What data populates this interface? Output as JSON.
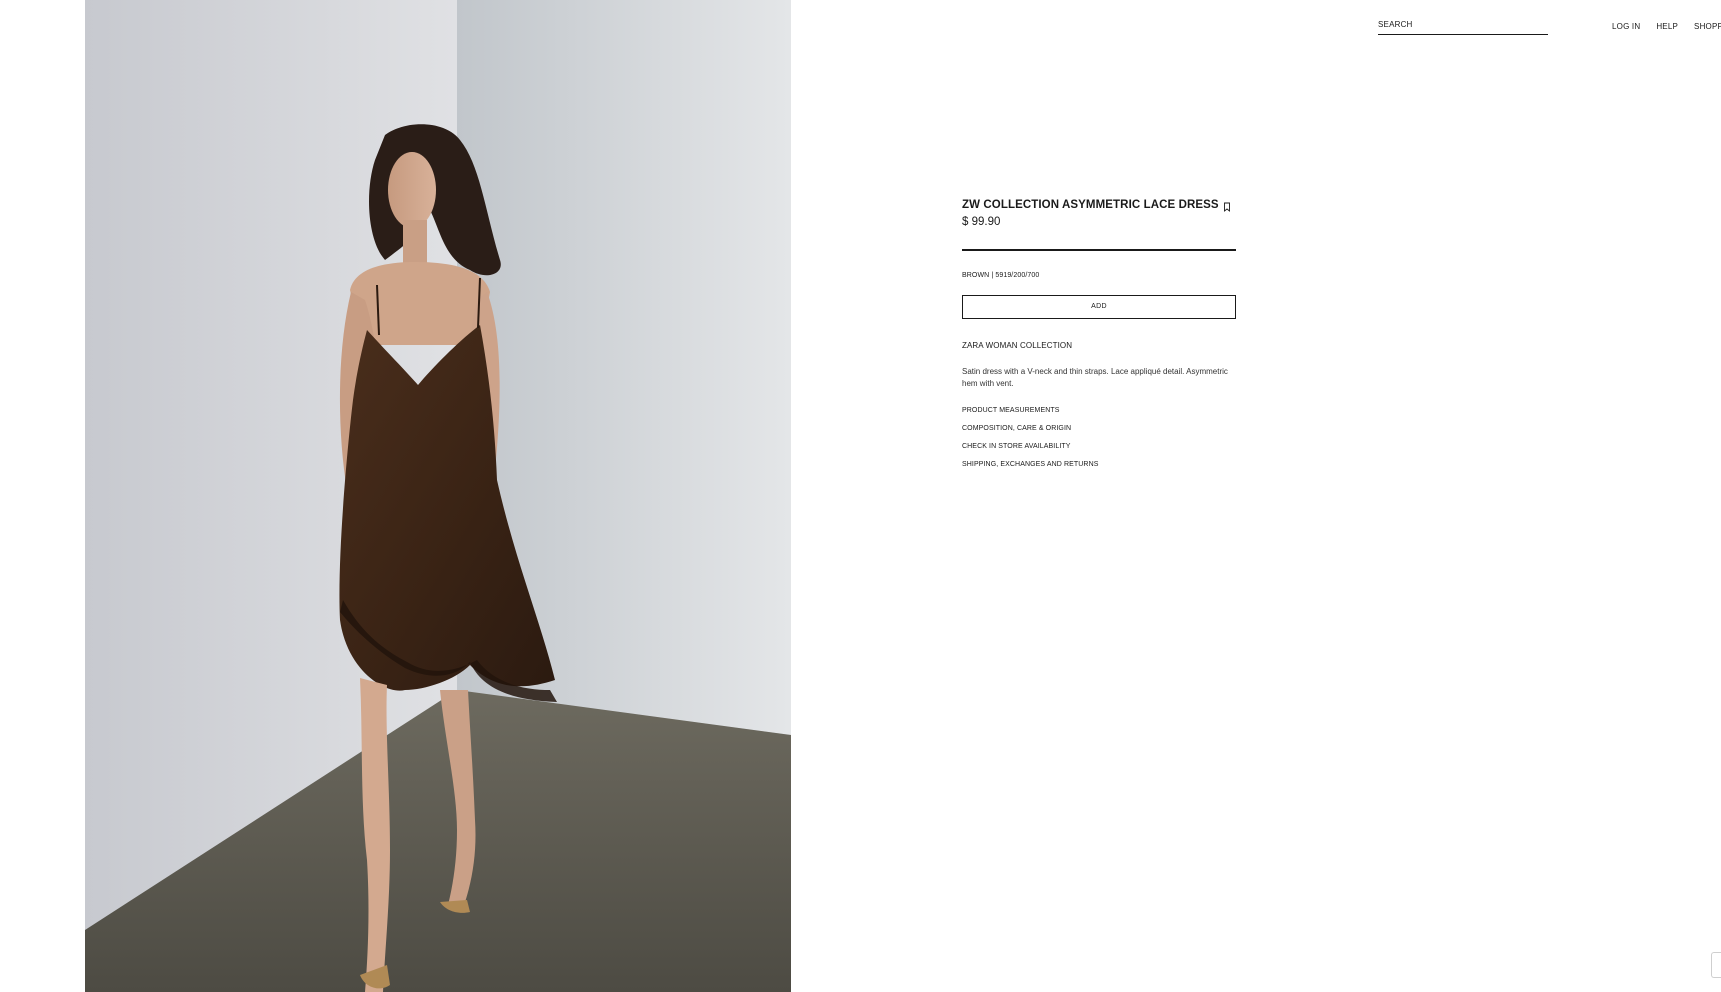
{
  "header": {
    "search_placeholder": "SEARCH",
    "nav": [
      "LOG IN",
      "HELP",
      "SHOPPING"
    ]
  },
  "product": {
    "title": "ZW COLLECTION ASYMMETRIC LACE DRESS",
    "price": "$ 99.90",
    "color_ref": "BROWN | 5919/200/700",
    "add_label": "ADD",
    "collection": "ZARA WOMAN COLLECTION",
    "description": "Satin dress with a V-neck and thin straps. Lace appliqué detail. Asymmetric hem with vent.",
    "links": [
      "PRODUCT MEASUREMENTS",
      "COMPOSITION, CARE & ORIGIN",
      "CHECK IN STORE AVAILABILITY",
      "SHIPPING, EXCHANGES AND RETURNS"
    ],
    "dress_color": "#3f2818"
  },
  "icons": {
    "bookmark": "bookmark-icon"
  }
}
